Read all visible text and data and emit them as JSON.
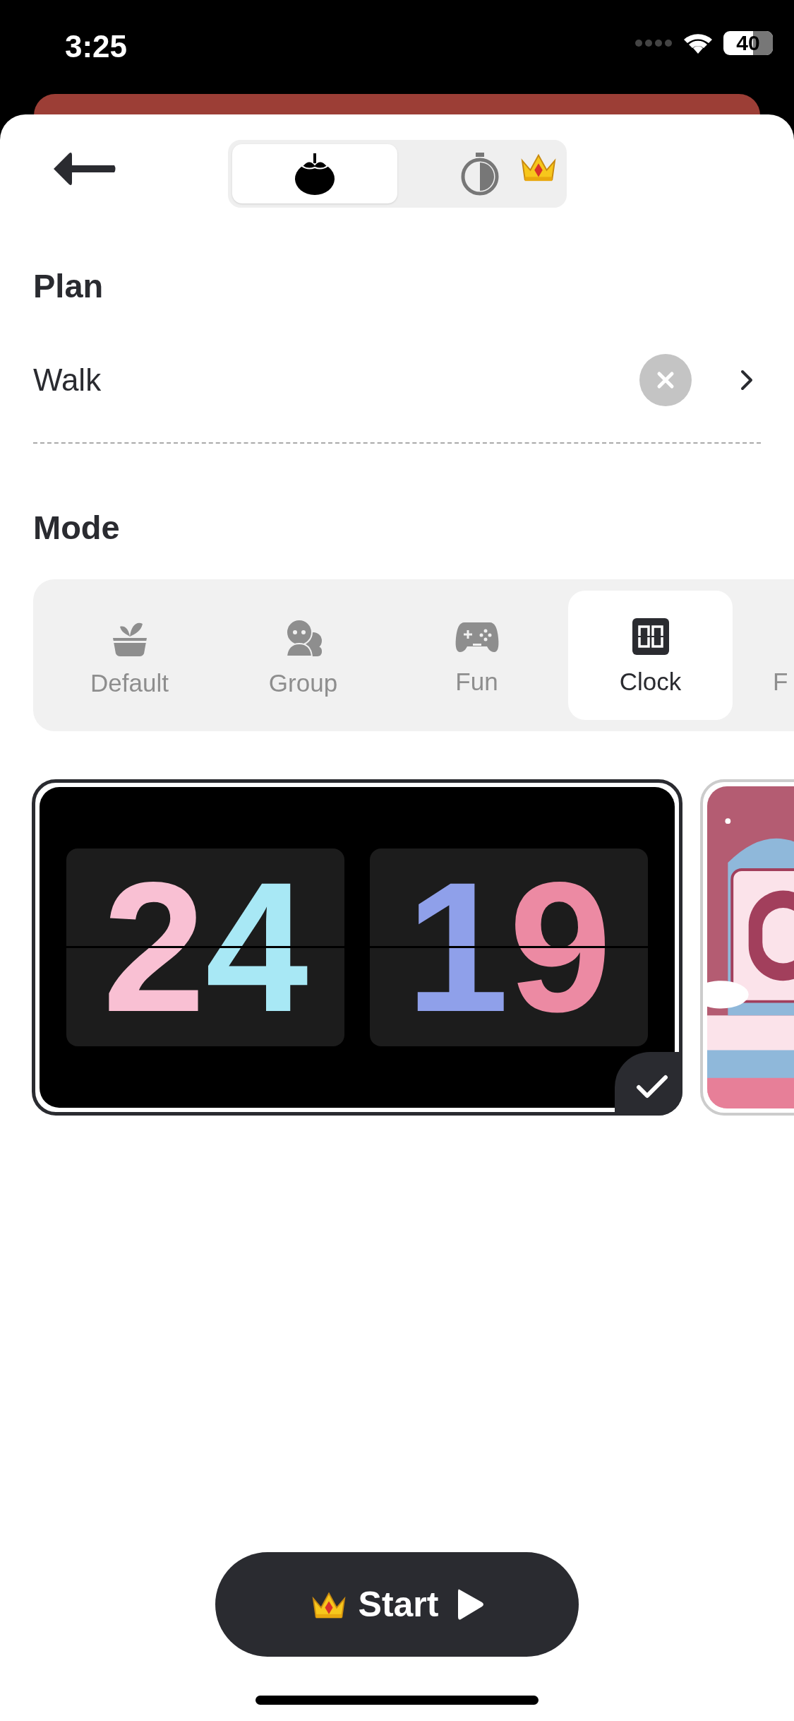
{
  "status_bar": {
    "time": "3:25",
    "battery": "40"
  },
  "header": {
    "tabs": [
      {
        "kind": "fruit",
        "selected": true,
        "premium": false
      },
      {
        "kind": "timer",
        "selected": false,
        "premium": true
      }
    ]
  },
  "plan": {
    "heading": "Plan",
    "value": "Walk"
  },
  "mode": {
    "heading": "Mode",
    "items": [
      {
        "kind": "default",
        "label": "Default",
        "selected": false
      },
      {
        "kind": "group",
        "label": "Group",
        "selected": false
      },
      {
        "kind": "fun",
        "label": "Fun",
        "selected": false
      },
      {
        "kind": "clock",
        "label": "Clock",
        "selected": true
      },
      {
        "kind": "other",
        "label": "F",
        "selected": false
      }
    ]
  },
  "clock_styles": [
    {
      "kind": "flip",
      "selected": true,
      "digits": [
        {
          "text": "2",
          "color": "#f9c0d3"
        },
        {
          "text": "4",
          "color": "#a8e8f5"
        },
        {
          "text": "1",
          "color": "#8fa0ea"
        },
        {
          "text": "9",
          "color": "#ec8aa3"
        }
      ]
    },
    {
      "kind": "picture",
      "selected": false
    }
  ],
  "start_button": {
    "label": "Start",
    "premium": true
  }
}
